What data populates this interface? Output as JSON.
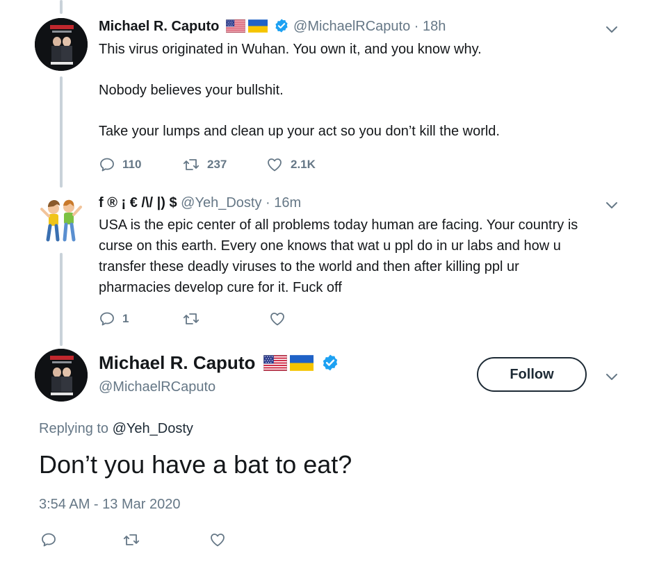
{
  "tweet1": {
    "name": "Michael R. Caputo",
    "handle": "@MichaelRCaputo",
    "separator": "·",
    "time": "18h",
    "lines": [
      "This virus originated in Wuhan. You own it, and you know why.",
      "Nobody believes your bullshit.",
      "Take your lumps and clean up your act so you don’t kill the world."
    ],
    "replies": "110",
    "retweets": "237",
    "likes": "2.1K"
  },
  "tweet2": {
    "name": "f ® ¡ € /\\/ |) $",
    "handle": "@Yeh_Dosty",
    "separator": "·",
    "time": "16m",
    "lines": [
      "USA is the epic center of all problems today human are facing. Your country is",
      "curse on this earth. Every one knows that wat u ppl do in ur labs and how u",
      "transfer these deadly viruses to the world and then after killing ppl ur",
      "pharmacies develop cure for it. Fuck off"
    ],
    "replies": "1"
  },
  "main": {
    "name": "Michael R. Caputo",
    "handle": "@MichaelRCaputo",
    "follow_label": "Follow",
    "replying_prefix": "Replying to",
    "replying_to": "@Yeh_Dosty",
    "text": "Don’t you have a bat to eat?",
    "timestamp": "3:54 AM - 13 Mar 2020"
  },
  "icons": {
    "reply": "reply-icon",
    "retweet": "retweet-icon",
    "like": "heart-icon",
    "more": "chevron-down-icon",
    "verified": "verified-badge-icon",
    "flag_us": "us-flag-icon",
    "flag_ua": "ukraine-flag-icon"
  },
  "colors": {
    "verified": "#1da1f2",
    "secondary_text": "#657786",
    "thread_line": "#c9d2d9"
  }
}
